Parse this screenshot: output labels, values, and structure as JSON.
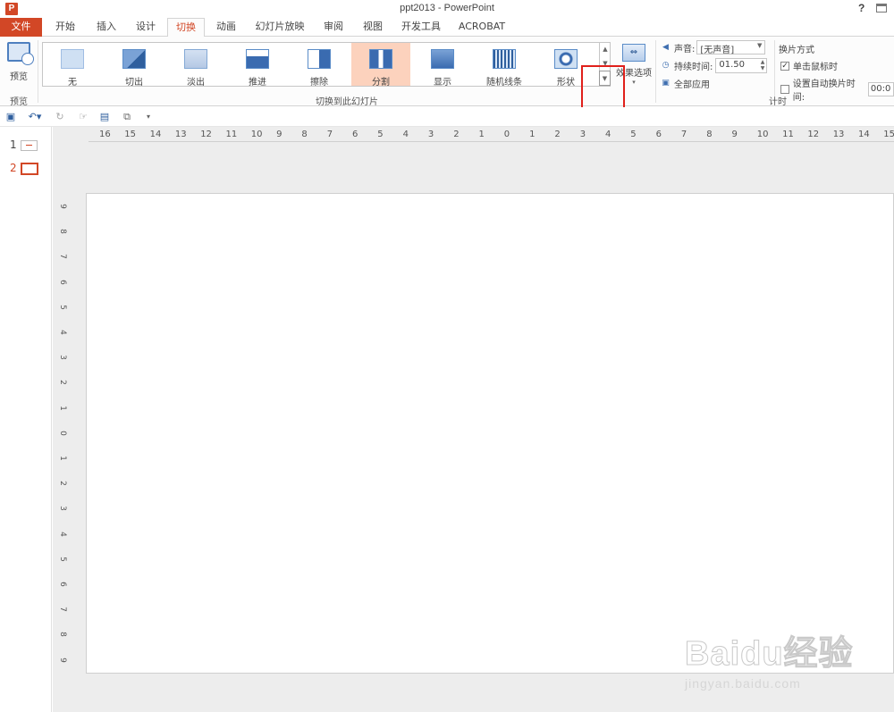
{
  "window": {
    "title": "ppt2013 - PowerPoint",
    "app_logo": "P",
    "help": "?"
  },
  "tabs": [
    "文件",
    "开始",
    "插入",
    "设计",
    "切换",
    "动画",
    "幻灯片放映",
    "审阅",
    "视图",
    "开发工具",
    "ACROBAT"
  ],
  "active_tab": "切换",
  "ribbon": {
    "preview": {
      "label": "预览",
      "group_label": "预览"
    },
    "transitions": {
      "group_label": "切换到此幻灯片",
      "items": [
        "无",
        "切出",
        "淡出",
        "推进",
        "擦除",
        "分割",
        "显示",
        "随机线条",
        "形状"
      ],
      "selected": "分割",
      "more_glyph": "▼"
    },
    "effect_options": {
      "label": "效果选项",
      "arrow": "▾"
    },
    "timing": {
      "sound_label": "声音:",
      "sound_value": "[无声音]",
      "duration_label": "持续时间:",
      "duration_value": "01.50",
      "apply_all_label": "全部应用",
      "advance_header": "换片方式",
      "on_click_label": "单击鼠标时",
      "on_click_checked": true,
      "auto_after_label": "设置自动换片时间:",
      "auto_after_value": "00:0",
      "group_label": "计时"
    }
  },
  "qat": [
    "save-icon",
    "undo-icon",
    "redo-icon",
    "touch-mode-icon",
    "save-as-icon",
    "copy-icon",
    "customize-icon"
  ],
  "slides_pane": {
    "numbers": [
      "1",
      "2"
    ],
    "active": "2"
  },
  "ruler": {
    "horizontal": [
      "16",
      "15",
      "14",
      "13",
      "12",
      "11",
      "10",
      "9",
      "8",
      "7",
      "6",
      "5",
      "4",
      "3",
      "2",
      "1",
      "0",
      "1",
      "2",
      "3",
      "4",
      "5",
      "6",
      "7",
      "8",
      "9",
      "10",
      "11",
      "12",
      "13",
      "14",
      "15"
    ],
    "vertical": [
      "9",
      "8",
      "7",
      "6",
      "5",
      "4",
      "3",
      "2",
      "1",
      "0",
      "1",
      "2",
      "3",
      "4",
      "5",
      "6",
      "7",
      "8",
      "9"
    ]
  },
  "watermark": {
    "logo": "Baidu经验",
    "url": "jingyan.baidu.com"
  },
  "colors": {
    "accent": "#d24726",
    "highlight_box": "#e0201b",
    "selected_item": "#fcd2bd"
  }
}
